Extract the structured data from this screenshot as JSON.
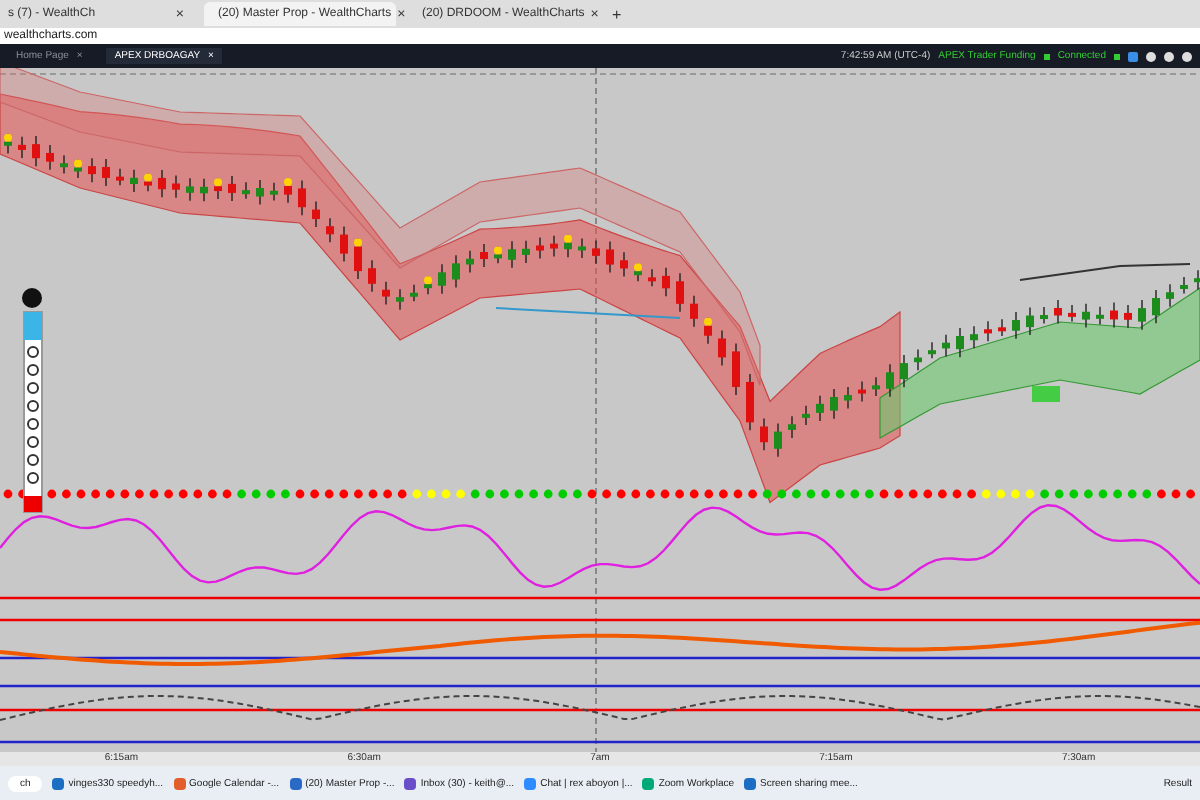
{
  "browser_tabs": [
    {
      "label": "s (7) - WealthCh",
      "selected": false
    },
    {
      "label": "(20) Master Prop - WealthCharts",
      "selected": true
    },
    {
      "label": "(20) DRDOOM - WealthCharts",
      "selected": false
    }
  ],
  "tab_close": "×",
  "new_tab": "+",
  "address": "wealthcharts.com",
  "app_tabs": [
    {
      "label": "Home Page",
      "selected": false
    },
    {
      "label": "APEX DRBOAGAY",
      "selected": true
    }
  ],
  "status": {
    "time": "7:42:59 AM (UTC-4)",
    "account": "APEX Trader Funding",
    "connection": "Connected"
  },
  "time_axis": [
    "6:15am",
    "6:30am",
    "7am",
    "7:15am",
    "7:30am"
  ],
  "taskbar": {
    "search": "ch",
    "apps": [
      "vinges330 speedyh...",
      "Google Calendar -...",
      "(20) Master Prop -...",
      "Inbox (30) - keith@...",
      "Chat | rex aboyon |...",
      "Zoom Workplace",
      "Screen sharing mee..."
    ],
    "weather": "Result"
  }
}
